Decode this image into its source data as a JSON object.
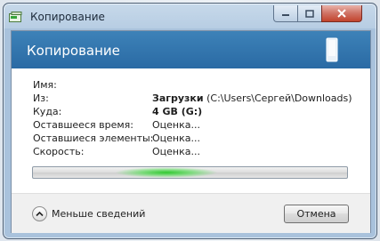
{
  "window": {
    "title": "Копирование",
    "icon": "copy-progress-icon",
    "controls": [
      "minimize-icon",
      "maximize-icon",
      "close-icon"
    ]
  },
  "header": {
    "title": "Копирование",
    "icon": "drive-icon"
  },
  "info": {
    "name_label": "Имя:",
    "name_value": "",
    "from_label": "Из:",
    "from_value_bold": "Загрузки",
    "from_value_path": "(C:\\Users\\Сергей\\Downloads)",
    "to_label": "Куда:",
    "to_value": "4 GB (G:)",
    "time_left_label": "Оставшееся время:",
    "time_left_value": "Оценка...",
    "items_left_label": "Оставшиеся элементы:",
    "items_left_value": "Оценка...",
    "speed_label": "Скорость:",
    "speed_value": "Оценка..."
  },
  "progress": {
    "state": "indeterminate",
    "highlight_color": "#2ecc40"
  },
  "footer": {
    "details_label": "Меньше сведений",
    "details_icon": "chevron-up-icon",
    "cancel_label": "Отмена"
  },
  "colors": {
    "header_band": "#2f73ad",
    "close_button": "#c7483a"
  }
}
